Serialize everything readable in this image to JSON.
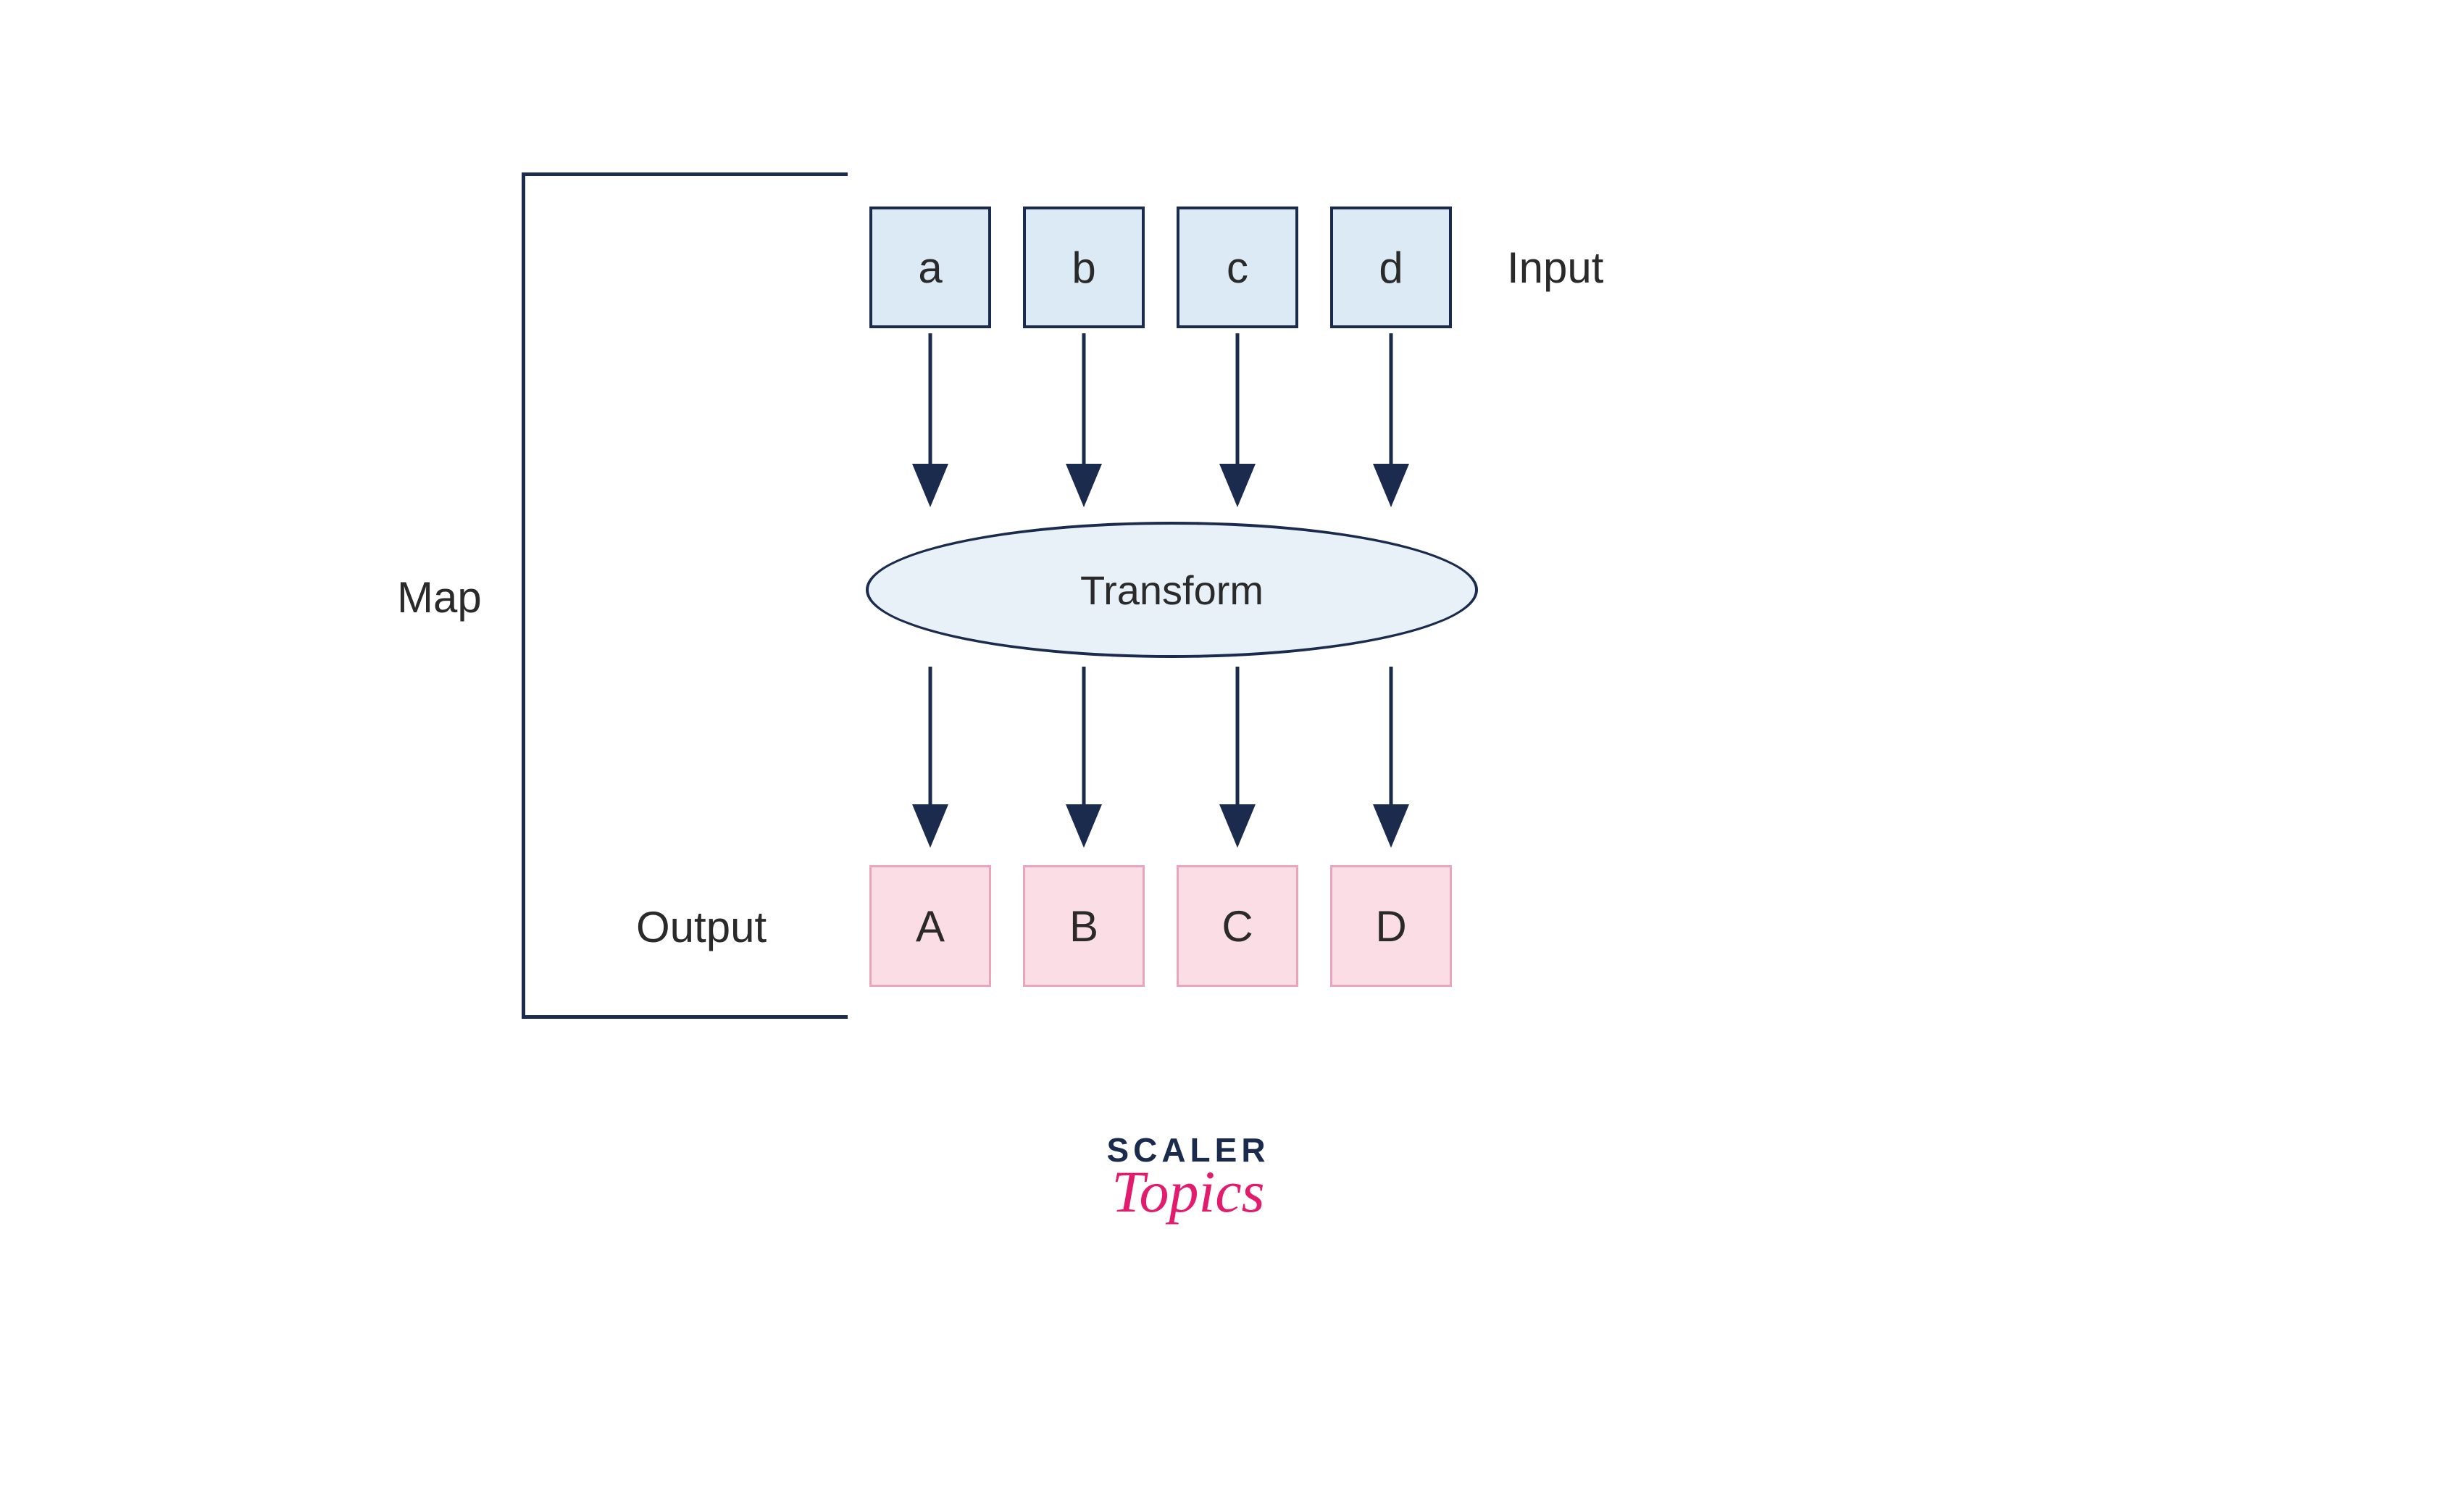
{
  "diagram": {
    "map_label": "Map",
    "input_label": "Input",
    "output_label": "Output",
    "transform_label": "Transform",
    "inputs": [
      "a",
      "b",
      "c",
      "d"
    ],
    "outputs": [
      "A",
      "B",
      "C",
      "D"
    ]
  },
  "branding": {
    "line1": "SCALER",
    "line2": "Topics"
  },
  "colors": {
    "dark_navy": "#1a2b4d",
    "light_blue": "#dbeaf5",
    "light_pink": "#fbdde6",
    "pink_border": "#e8a5bb",
    "ellipse_blue": "#e8f1f8",
    "brand_pink": "#e31b6d"
  }
}
